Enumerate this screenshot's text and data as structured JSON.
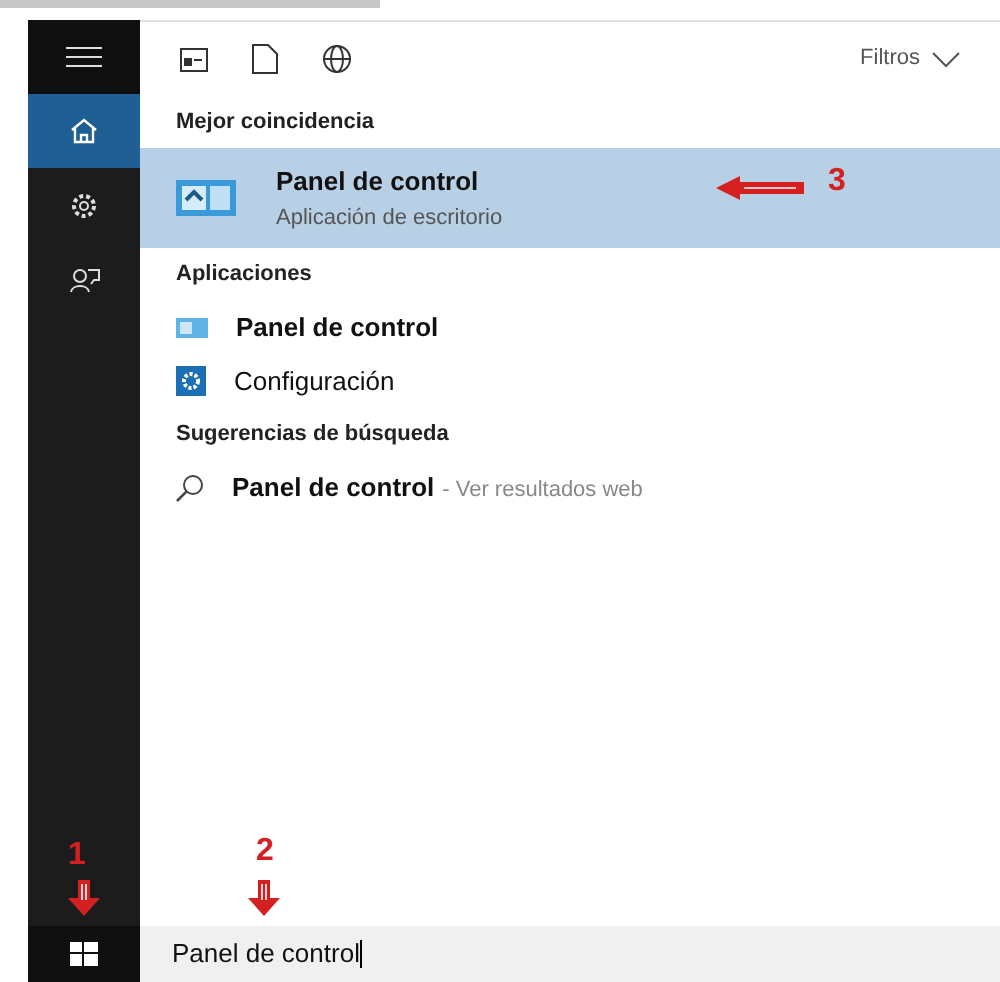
{
  "sidebar": {
    "items": [
      {
        "kind": "menu",
        "selected": false
      },
      {
        "kind": "home",
        "selected": true
      },
      {
        "kind": "settings",
        "selected": false
      },
      {
        "kind": "feedback",
        "selected": false
      }
    ]
  },
  "toolbar": {
    "filters_label": "Filtros"
  },
  "sections": [
    {
      "title": "Mejor coincidencia",
      "items": [
        {
          "kind": "app",
          "title": "Panel de control",
          "subtitle": "Aplicación de escritorio",
          "selected": true
        }
      ]
    },
    {
      "title": "Aplicaciones",
      "items": [
        {
          "kind": "control-panel",
          "title": "Panel de control",
          "selected": false
        },
        {
          "kind": "settings",
          "title": "Configuración",
          "selected": false
        }
      ]
    },
    {
      "title": "Sugerencias de búsqueda",
      "items": [
        {
          "kind": "web",
          "title": "Panel de control",
          "suffix": "- Ver resultados web",
          "selected": false
        }
      ]
    }
  ],
  "annotations": [
    {
      "label": "1"
    },
    {
      "label": "2"
    },
    {
      "label": "3"
    }
  ],
  "search": {
    "value": "Panel de control"
  }
}
